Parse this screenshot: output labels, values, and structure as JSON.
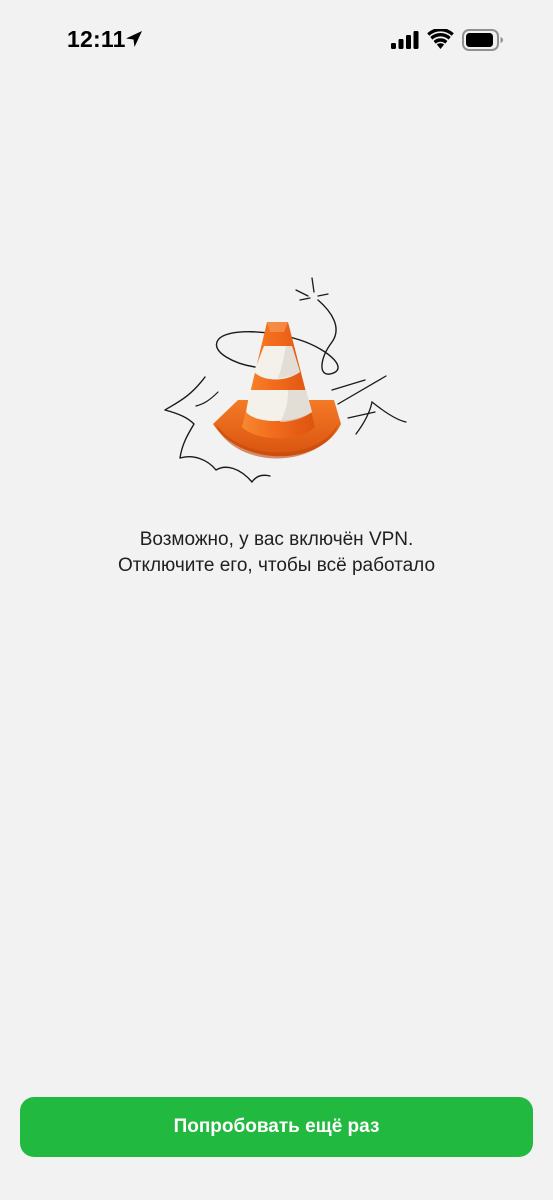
{
  "status_bar": {
    "time": "12:11",
    "location_icon": "location-arrow-icon",
    "signal_icon": "cellular-signal-icon",
    "wifi_icon": "wifi-icon",
    "battery_icon": "battery-icon"
  },
  "illustration": {
    "icon": "traffic-cone-icon",
    "colors": {
      "cone": "#f26a1b",
      "stripe": "#f4f0ea",
      "line": "#1a1a1a"
    }
  },
  "message": {
    "line1": "Возможно, у вас включён VPN.",
    "line2": "Отключите его, чтобы всё работало"
  },
  "retry_button": {
    "label": "Попробовать ещё раз",
    "color": "#21b93f"
  },
  "colors": {
    "background": "#f2f2f2",
    "text": "#1f1f1f"
  }
}
